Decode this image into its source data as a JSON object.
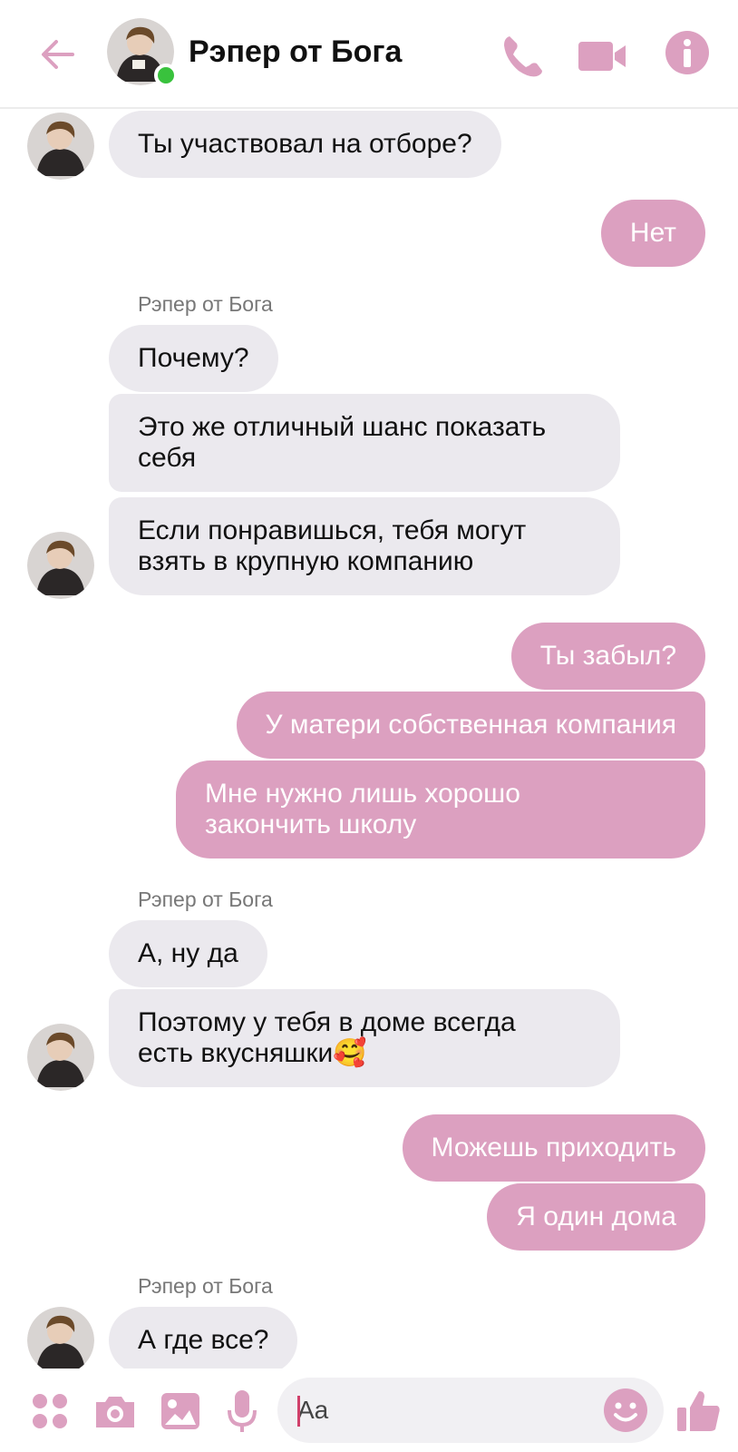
{
  "header": {
    "title": "Рэпер от Бога"
  },
  "colors": {
    "accent": "#dca0c0",
    "incoming_bubble": "#ebe9ee",
    "presence": "#39c23d"
  },
  "messages": [
    {
      "direction": "in",
      "text_lines": [
        "Ты участвовал на отборе?"
      ]
    },
    {
      "direction": "out",
      "text_lines": [
        "Нет"
      ]
    },
    {
      "direction": "in",
      "sender": "Рэпер от Бога",
      "text_lines": [
        "Почему?"
      ]
    },
    {
      "direction": "in",
      "text_lines": [
        "Это же отличный шанс показать",
        "себя"
      ]
    },
    {
      "direction": "in",
      "text_lines": [
        "Если понравишься, тебя могут",
        "взять в крупную компанию"
      ]
    },
    {
      "direction": "out",
      "text_lines": [
        "Ты забыл?"
      ]
    },
    {
      "direction": "out",
      "text_lines": [
        "У матери собственная компания"
      ]
    },
    {
      "direction": "out",
      "text_lines": [
        "Мне нужно лишь хорошо",
        "закончить школу"
      ]
    },
    {
      "direction": "in",
      "sender": "Рэпер от Бога",
      "text_lines": [
        "А, ну да"
      ]
    },
    {
      "direction": "in",
      "text_lines": [
        "Поэтому у тебя в доме всегда",
        "есть вкусняшки🥰"
      ]
    },
    {
      "direction": "out",
      "text_lines": [
        "Можешь приходить"
      ]
    },
    {
      "direction": "out",
      "text_lines": [
        "Я один дома"
      ]
    },
    {
      "direction": "in",
      "sender": "Рэпер от Бога",
      "text_lines": [
        "А где все?"
      ]
    }
  ],
  "composer": {
    "placeholder": "Aa"
  },
  "icons": {
    "back": "arrow-left-icon",
    "call": "phone-icon",
    "video": "video-camera-icon",
    "info": "info-icon",
    "menu": "four-dots-icon",
    "camera": "camera-icon",
    "gallery": "image-icon",
    "mic": "microphone-icon",
    "emoji": "smiley-icon",
    "like": "thumbs-up-icon"
  }
}
